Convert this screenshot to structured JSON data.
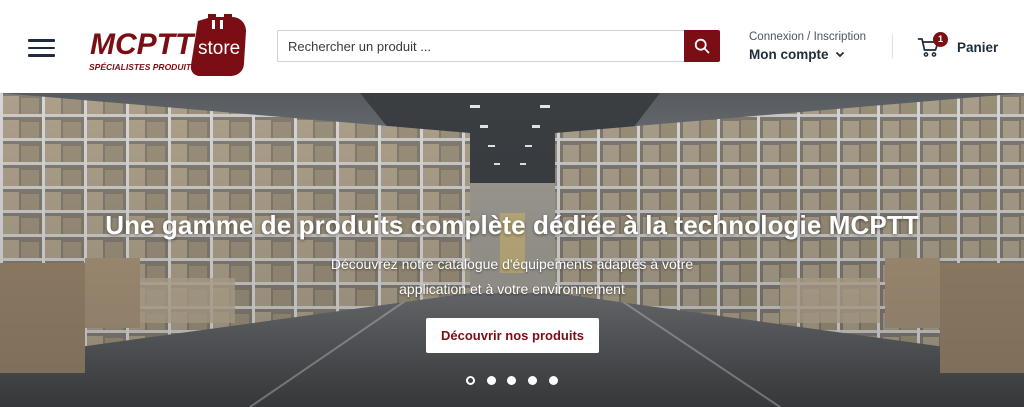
{
  "header": {
    "logo": {
      "brand": "MCPTT",
      "suffix": "store",
      "tagline": "SPÉCIALISTES PRODUITS"
    },
    "search": {
      "placeholder": "Rechercher un produit ...",
      "value": ""
    },
    "account": {
      "top_label": "Connexion / Inscription",
      "main_label": "Mon compte"
    },
    "cart": {
      "label": "Panier",
      "count": "1"
    }
  },
  "hero": {
    "title": "Une gamme de produits complète dédiée à la technologie MCPTT",
    "subtitle_line1": "Découvrez notre catalogue d'équipements adaptés à votre",
    "subtitle_line2": "application et à votre environnement",
    "cta_label": "Découvrir nos produits",
    "slides_total": 5,
    "active_slide": 1
  },
  "colors": {
    "brand_red": "#7a0e14",
    "text_dark": "#1e2d3d",
    "white": "#ffffff"
  },
  "icons": [
    "menu-icon",
    "search-icon",
    "chevron-down-icon",
    "cart-icon"
  ]
}
